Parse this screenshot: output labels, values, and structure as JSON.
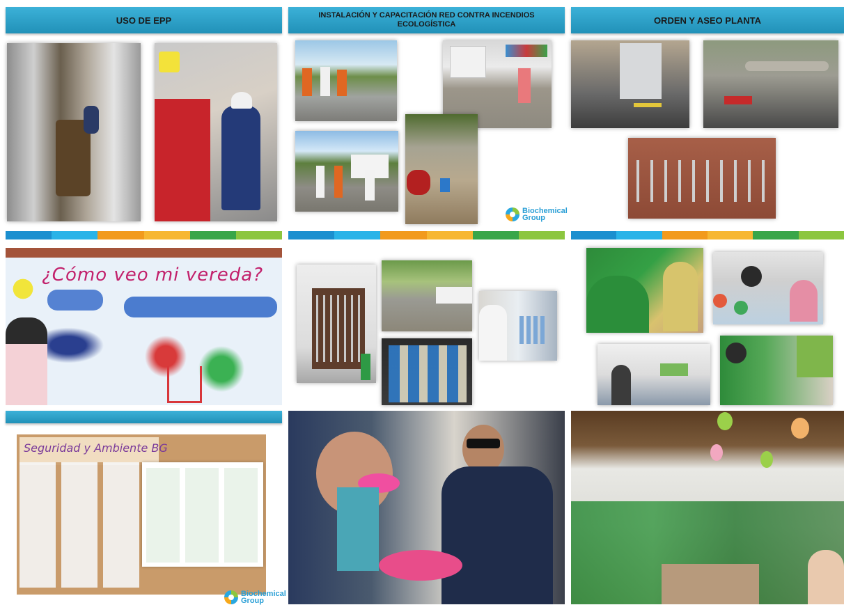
{
  "headers": {
    "epp": "USO DE EPP",
    "red_incendios": "INSTALACIÓN Y CAPACITACIÓN RED CONTRA INCENDIOS ECOLOGÍSTICA",
    "orden_aseo": "ORDEN Y ASEO PLANTA"
  },
  "mural": {
    "caption": "¿Cómo veo mi vereda?"
  },
  "board": {
    "title": "Seguridad y Ambiente BG"
  },
  "logos": {
    "top": {
      "line1": "Biochemical",
      "line2": "Group"
    },
    "bottom": {
      "line1": "Biochemical",
      "line2": "Group"
    }
  },
  "colors": {
    "header": "#2a9fc9",
    "stripe": [
      "#1b8fcf",
      "#29b3e8",
      "#f29a1c",
      "#f7b731",
      "#38a649",
      "#8cc63f"
    ]
  }
}
